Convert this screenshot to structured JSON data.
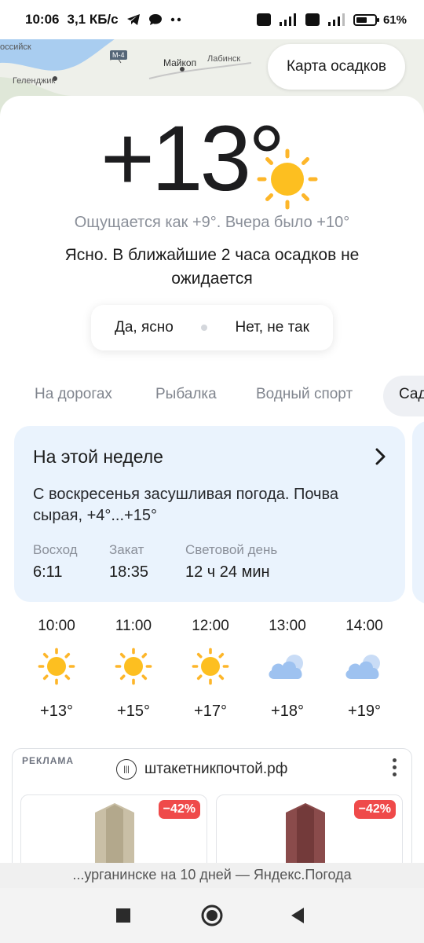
{
  "status": {
    "time": "10:06",
    "speed": "3,1 КБ/с",
    "battery": "61",
    "battery_level": 0.61
  },
  "map": {
    "labels": [
      "оссийск",
      "Майкоп",
      "Лабинск",
      "Геленджик",
      "М-4"
    ],
    "precip_button": "Карта осадков"
  },
  "current": {
    "temperature": "+13°",
    "feels": "Ощущается как +9°. Вчера было +10°",
    "condition": "Ясно. В ближайшие 2 часа осадков не ожидается",
    "icon": "sun-icon"
  },
  "feedback": {
    "yes": "Да, ясно",
    "no": "Нет, не так"
  },
  "tabs": {
    "items": [
      "На дорогах",
      "Рыбалка",
      "Водный спорт"
    ],
    "active": "Сад"
  },
  "week": {
    "title": "На этой неделе",
    "text": "С воскресенья засушливая погода. Почва сырая, +4°...+15°",
    "sunrise_label": "Восход",
    "sunrise": "6:11",
    "sunset_label": "Закат",
    "sunset": "18:35",
    "daylight_label": "Световой день",
    "daylight": "12 ч 24 мин"
  },
  "hourly": [
    {
      "time": "10:00",
      "temp": "+13°",
      "icon": "sun-icon"
    },
    {
      "time": "11:00",
      "temp": "+15°",
      "icon": "sun-icon"
    },
    {
      "time": "12:00",
      "temp": "+17°",
      "icon": "sun-icon"
    },
    {
      "time": "13:00",
      "temp": "+18°",
      "icon": "cloud-icon"
    },
    {
      "time": "14:00",
      "temp": "+19°",
      "icon": "cloud-icon"
    }
  ],
  "ad": {
    "tag": "РЕКЛАМА",
    "site": "штакетникпочтой.рф",
    "discount1": "−42%",
    "discount2": "−42%"
  },
  "urlbar": "...урганинске на 10 дней — Яндекс.Погода",
  "colors": {
    "sun": "#fdbf20",
    "sun_rays": "#fdb62a",
    "cloud": "#9ec2f0",
    "card_bg": "#eaf3fd",
    "discount": "#ef4a4a"
  }
}
